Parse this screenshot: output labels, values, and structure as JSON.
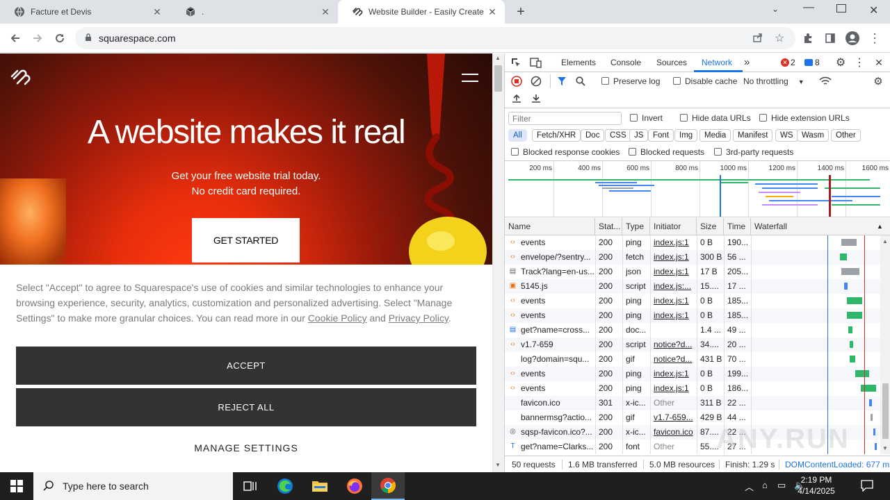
{
  "browser": {
    "tabs": [
      {
        "title": "Facture et Devis",
        "icon": "globe-icon",
        "active": false
      },
      {
        "title": ".",
        "icon": "cube-icon",
        "active": false
      },
      {
        "title": "Website Builder - Easily Create Y",
        "icon": "squarespace-icon",
        "active": true
      }
    ],
    "url": "squarespace.com"
  },
  "page": {
    "headline": "A website makes it real",
    "sub1": "Get your free website trial today.",
    "sub2": "No credit card required.",
    "cta": "GET STARTED",
    "cookie_text_1": "Select \"Accept\" to agree to Squarespace's use of cookies and similar technologies to enhance your browsing experience, security, analytics, customization and personalized advertising. Select \"Manage Settings\" to make more granular choices. You can read more in our ",
    "cookie_link": "Cookie Policy",
    "cookie_and": " and ",
    "privacy_link": "Privacy Policy",
    "cookie_end": ".",
    "accept": "ACCEPT",
    "reject": "REJECT ALL",
    "manage": "MANAGE SETTINGS"
  },
  "devtools": {
    "tabs": [
      "Elements",
      "Console",
      "Sources",
      "Network"
    ],
    "active_tab": "Network",
    "more": "»",
    "errors": "2",
    "messages": "8",
    "preserve_log": "Preserve log",
    "disable_cache": "Disable cache",
    "throttling": "No throttling",
    "filter_placeholder": "Filter",
    "invert": "Invert",
    "hide_data_urls": "Hide data URLs",
    "hide_ext_urls": "Hide extension URLs",
    "type_filters": [
      "All",
      "Fetch/XHR",
      "Doc",
      "CSS",
      "JS",
      "Font",
      "Img",
      "Media",
      "Manifest",
      "WS",
      "Wasm",
      "Other"
    ],
    "blocked_cookies": "Blocked response cookies",
    "blocked_requests": "Blocked requests",
    "third_party": "3rd-party requests",
    "timeline_ticks": [
      "200 ms",
      "400 ms",
      "600 ms",
      "800 ms",
      "1000 ms",
      "1200 ms",
      "1400 ms",
      "1600 ms"
    ],
    "columns": [
      "Name",
      "Stat...",
      "Type",
      "Initiator",
      "Size",
      "Time",
      "Waterfall"
    ],
    "rows": [
      {
        "name": "events",
        "status": "200",
        "type": "ping",
        "initiator": "index.js:1",
        "size": "0 B",
        "time": "190...",
        "icon": "code-icon"
      },
      {
        "name": "envelope/?sentry...",
        "status": "200",
        "type": "fetch",
        "initiator": "index.js:1",
        "size": "300 B",
        "time": "56 ...",
        "icon": "code-icon"
      },
      {
        "name": "Track?lang=en-us...",
        "status": "200",
        "type": "json",
        "initiator": "index.js:1",
        "size": "17 B",
        "time": "205...",
        "icon": "doc-icon"
      },
      {
        "name": "5145.js",
        "status": "200",
        "type": "script",
        "initiator": "index.js:...",
        "size": "15....",
        "time": "17 ...",
        "icon": "script-icon"
      },
      {
        "name": "events",
        "status": "200",
        "type": "ping",
        "initiator": "index.js:1",
        "size": "0 B",
        "time": "185...",
        "icon": "code-icon"
      },
      {
        "name": "events",
        "status": "200",
        "type": "ping",
        "initiator": "index.js:1",
        "size": "0 B",
        "time": "185...",
        "icon": "code-icon"
      },
      {
        "name": "get?name=cross...",
        "status": "200",
        "type": "doc...",
        "initiator": "",
        "size": "1.4 ...",
        "time": "49 ...",
        "icon": "page-icon"
      },
      {
        "name": "v1.7-659",
        "status": "200",
        "type": "script",
        "initiator": "notice?d...",
        "size": "34....",
        "time": "20 ...",
        "icon": "code-icon"
      },
      {
        "name": "log?domain=squ...",
        "status": "200",
        "type": "gif",
        "initiator": "notice?d...",
        "size": "431 B",
        "time": "70 ...",
        "icon": "none"
      },
      {
        "name": "events",
        "status": "200",
        "type": "ping",
        "initiator": "index.js:1",
        "size": "0 B",
        "time": "199...",
        "icon": "code-icon"
      },
      {
        "name": "events",
        "status": "200",
        "type": "ping",
        "initiator": "index.js:1",
        "size": "0 B",
        "time": "186...",
        "icon": "code-icon"
      },
      {
        "name": "favicon.ico",
        "status": "301",
        "type": "x-ic...",
        "initiator": "Other",
        "size": "311 B",
        "time": "22 ...",
        "icon": "none"
      },
      {
        "name": "bannermsg?actio...",
        "status": "200",
        "type": "gif",
        "initiator": "v1.7-659...",
        "size": "429 B",
        "time": "44 ...",
        "icon": "none"
      },
      {
        "name": "sqsp-favicon.ico?...",
        "status": "200",
        "type": "x-ic...",
        "initiator": "favicon.ico",
        "size": "87....",
        "time": "22 ...",
        "icon": "squarespace-icon"
      },
      {
        "name": "get?name=Clarks...",
        "status": "200",
        "type": "font",
        "initiator": "Other",
        "size": "55....",
        "time": "27 ...",
        "icon": "font-icon"
      }
    ],
    "status_bar": {
      "requests": "50 requests",
      "transferred": "1.6 MB transferred",
      "resources": "5.0 MB resources",
      "finish": "Finish: 1.29 s",
      "dcl": "DOMContentLoaded: 677 ms"
    }
  },
  "taskbar": {
    "search_placeholder": "Type here to search",
    "time": "2:19 PM",
    "date": "4/14/2025"
  },
  "watermark": "ANY.RUN",
  "colors": {
    "accent": "#1a73e8",
    "error": "#d93025",
    "ping_green": "#2fb86b",
    "cookie_button": "#333333"
  }
}
